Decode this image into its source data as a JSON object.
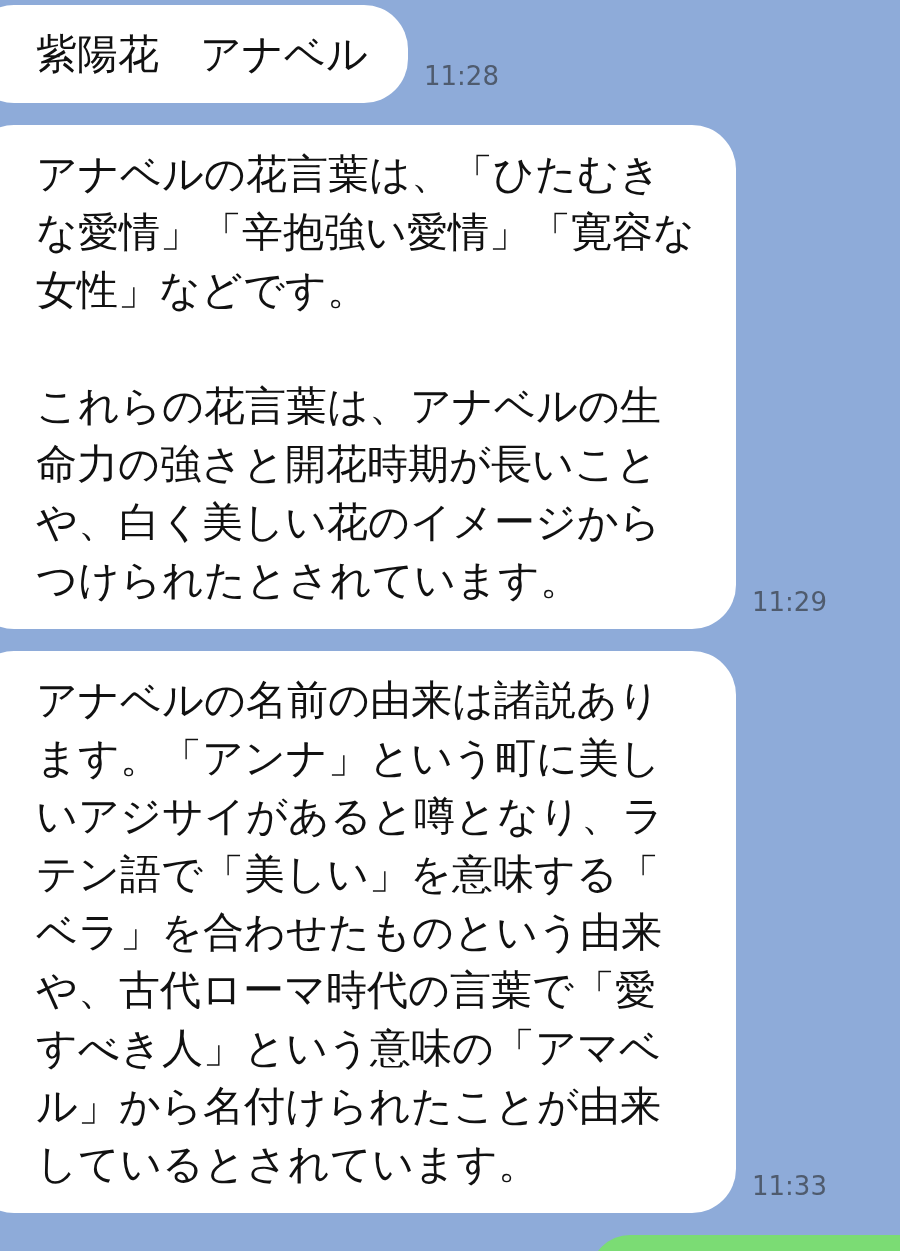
{
  "messages": [
    {
      "kind": "incoming",
      "paragraphs": [
        "紫陽花　アナベル"
      ],
      "time": "11:28"
    },
    {
      "kind": "incoming",
      "paragraphs": [
        "アナベルの花言葉は、「ひたむきな愛情」「辛抱強い愛情」「寛容な女性」などです。",
        "これらの花言葉は、アナベルの生命力の強さと開花時期が長いことや、白く美しい花のイメージからつけられたとされています。"
      ],
      "time": "11:29"
    },
    {
      "kind": "incoming",
      "paragraphs": [
        "アナベルの名前の由来は諸説あります。「アンナ」という町に美しいアジサイがあると噂となり、ラテン語で「美しい」を意味する「ベラ」を合わせたものという由来や、古代ローマ時代の言葉で「愛すべき人」という意味の「アマベル」から名付けられたことが由来しているとされています。"
      ],
      "time": "11:33"
    },
    {
      "kind": "outgoing"
    }
  ]
}
